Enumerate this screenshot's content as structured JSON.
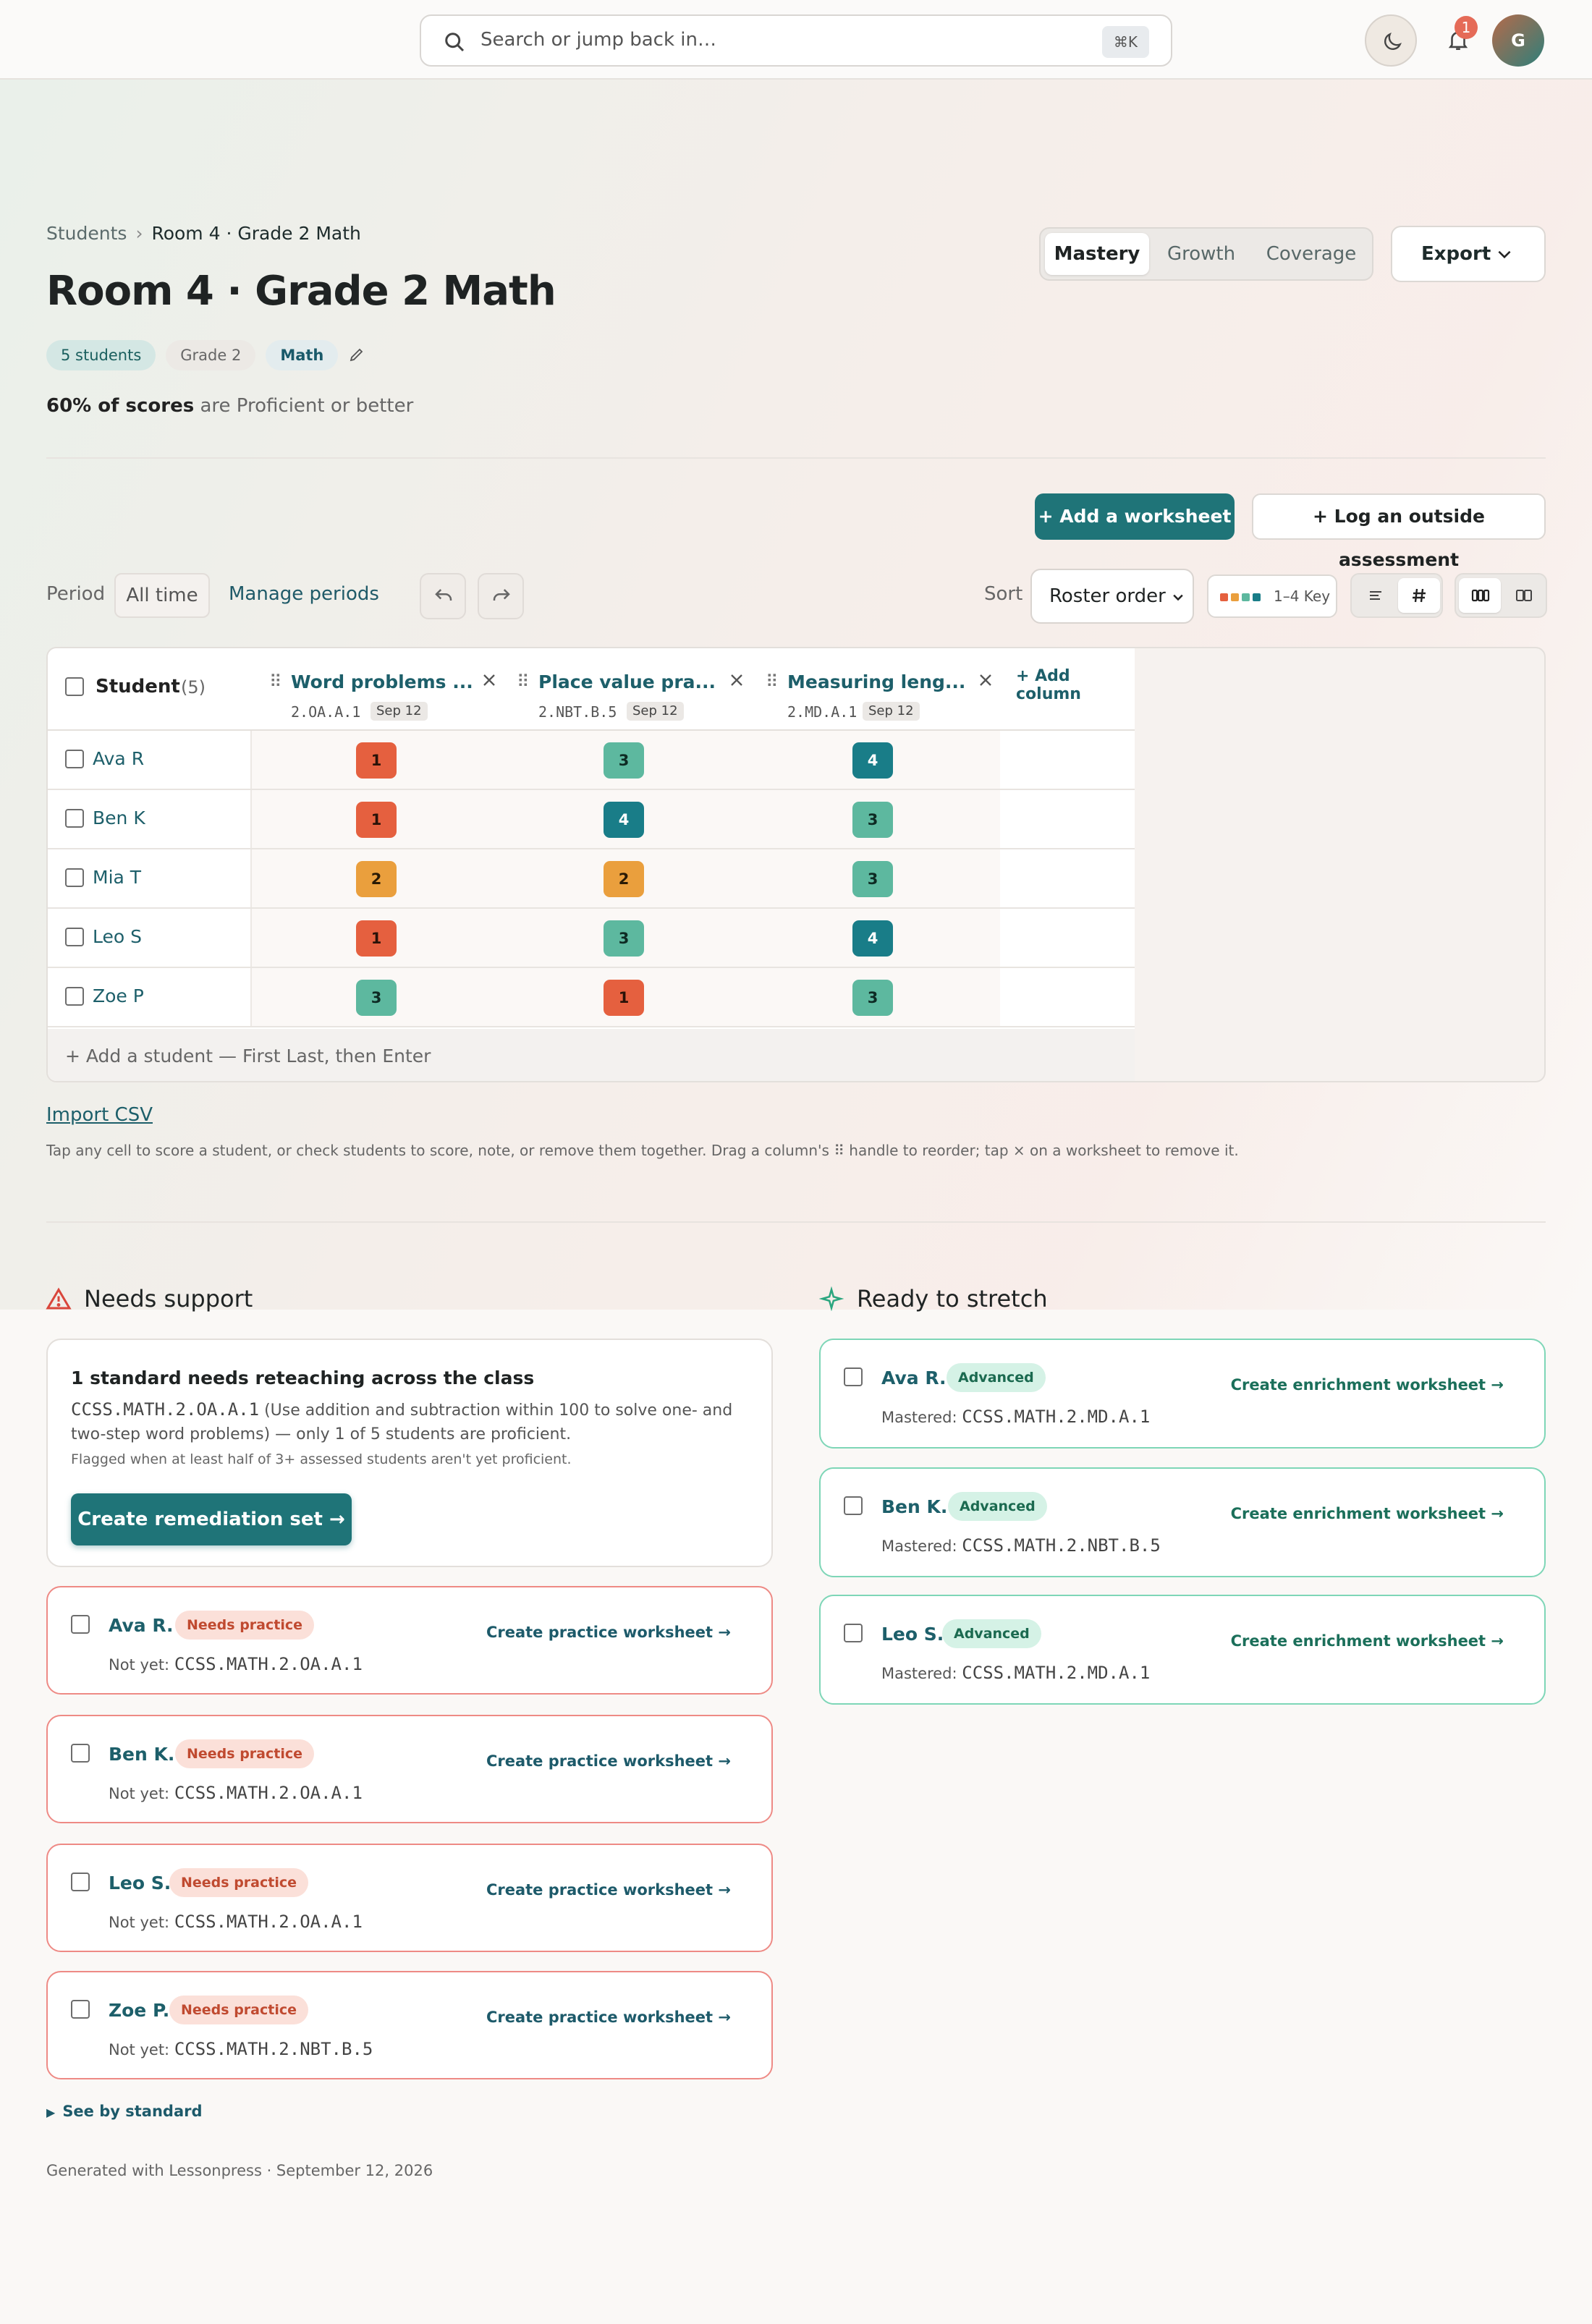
{
  "topbar": {
    "search_placeholder": "Search or jump back in…",
    "shortcut": "⌘K",
    "notification_count": "1",
    "avatar_initial": "G"
  },
  "breadcrumb": {
    "root": "Students",
    "separator": "›",
    "current": "Room 4 · Grade 2 Math"
  },
  "page_title": "Room 4 · Grade 2 Math",
  "chips": {
    "students": "5 students",
    "grade": "Grade 2",
    "subject": "Math"
  },
  "summary": {
    "bold": "60% of scores",
    "rest": " are Proficient or better"
  },
  "view_tabs": [
    {
      "label": "Mastery",
      "active": true
    },
    {
      "label": "Growth",
      "active": false
    },
    {
      "label": "Coverage",
      "active": false
    }
  ],
  "export_label": "Export",
  "actions": {
    "add_worksheet": "+ Add a worksheet",
    "log_assessment": "+ Log an outside assessment"
  },
  "toolbar": {
    "period_label": "Period",
    "period_value": "All time",
    "manage_periods": "Manage periods",
    "sort_label": "Sort",
    "sort_value": "Roster order",
    "key_label": "1–4 Key"
  },
  "colors": {
    "score1": "#e5603f",
    "score2": "#ea9f3d",
    "score3": "#5db89f",
    "score4": "#197d88",
    "accent": "#1f7478"
  },
  "table": {
    "student_header": "Student",
    "student_count": "(5)",
    "add_column": "+ Add column",
    "columns": [
      {
        "name": "Word problems ...",
        "code": "2.OA.A.1",
        "date": "Sep 12"
      },
      {
        "name": "Place value pra...",
        "code": "2.NBT.B.5",
        "date": "Sep 12"
      },
      {
        "name": "Measuring leng...",
        "code": "2.MD.A.1",
        "date": "Sep 12"
      }
    ],
    "rows": [
      {
        "name": "Ava R",
        "scores": [
          "1",
          "3",
          "4"
        ]
      },
      {
        "name": "Ben K",
        "scores": [
          "1",
          "4",
          "3"
        ]
      },
      {
        "name": "Mia T",
        "scores": [
          "2",
          "2",
          "3"
        ]
      },
      {
        "name": "Leo S",
        "scores": [
          "1",
          "3",
          "4"
        ]
      },
      {
        "name": "Zoe P",
        "scores": [
          "3",
          "1",
          "3"
        ]
      }
    ],
    "add_student": "+   Add a student — First Last, then Enter"
  },
  "import_csv": "Import CSV",
  "hint": "Tap any cell to score a student, or check students to score, note, or remove them together. Drag a column's ⠿ handle to reorder; tap × on a worksheet to remove it.",
  "needs_support": {
    "title": "Needs support",
    "summary_title": "1 standard needs reteaching across the class",
    "summary_code": "CCSS.MATH.2.OA.A.1",
    "summary_text": " (Use addition and subtraction within 100 to solve one- and two-step word problems) — only 1 of 5 students are proficient.",
    "flag_note": "Flagged when at least half of 3+ assessed students aren't yet proficient.",
    "cta": "Create remediation set →",
    "students": [
      {
        "name": "Ava R.",
        "badge": "Needs practice",
        "prefix": "Not yet: ",
        "code": "CCSS.MATH.2.OA.A.1",
        "link": "Create practice worksheet →"
      },
      {
        "name": "Ben K.",
        "badge": "Needs practice",
        "prefix": "Not yet: ",
        "code": "CCSS.MATH.2.OA.A.1",
        "link": "Create practice worksheet →"
      },
      {
        "name": "Leo S.",
        "badge": "Needs practice",
        "prefix": "Not yet: ",
        "code": "CCSS.MATH.2.OA.A.1",
        "link": "Create practice worksheet →"
      },
      {
        "name": "Zoe P.",
        "badge": "Needs practice",
        "prefix": "Not yet: ",
        "code": "CCSS.MATH.2.NBT.B.5",
        "link": "Create practice worksheet →"
      }
    ]
  },
  "ready_to_stretch": {
    "title": "Ready to stretch",
    "students": [
      {
        "name": "Ava R.",
        "badge": "Advanced",
        "prefix": "Mastered: ",
        "code": "CCSS.MATH.2.MD.A.1",
        "link": "Create enrichment worksheet →"
      },
      {
        "name": "Ben K.",
        "badge": "Advanced",
        "prefix": "Mastered: ",
        "code": "CCSS.MATH.2.NBT.B.5",
        "link": "Create enrichment worksheet →"
      },
      {
        "name": "Leo S.",
        "badge": "Advanced",
        "prefix": "Mastered: ",
        "code": "CCSS.MATH.2.MD.A.1",
        "link": "Create enrichment worksheet →"
      }
    ]
  },
  "see_by_standard": "See by standard",
  "footer": "Generated with Lessonpress · September 12, 2026"
}
